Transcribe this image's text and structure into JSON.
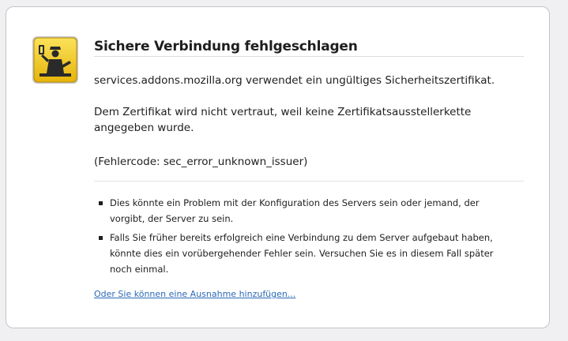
{
  "error": {
    "title": "Sichere Verbindung fehlgeschlagen",
    "paragraphs": [
      "services.addons.mozilla.org verwendet ein ungültiges Sicherheitszertifikat.",
      "Dem Zertifikat wird nicht vertraut, weil keine Zertifikatsausstellerkette angegeben wurde.",
      "(Fehlercode: sec_error_unknown_issuer)"
    ],
    "bullets": [
      "Dies könnte ein Problem mit der Konfiguration des Servers sein oder jemand, der vorgibt, der Server zu sein.",
      "Falls Sie früher bereits erfolgreich eine Verbindung zu dem Server aufgebaut haben, könnte dies ein vorübergehender Fehler sein. Versuchen Sie es in diesem Fall später noch einmal."
    ],
    "exception_link": "Oder Sie können eine Ausnahme hinzufügen...",
    "icon": "security-guard-icon",
    "colors": {
      "icon_yellow": "#f0c419",
      "link": "#2b6ab7"
    }
  }
}
